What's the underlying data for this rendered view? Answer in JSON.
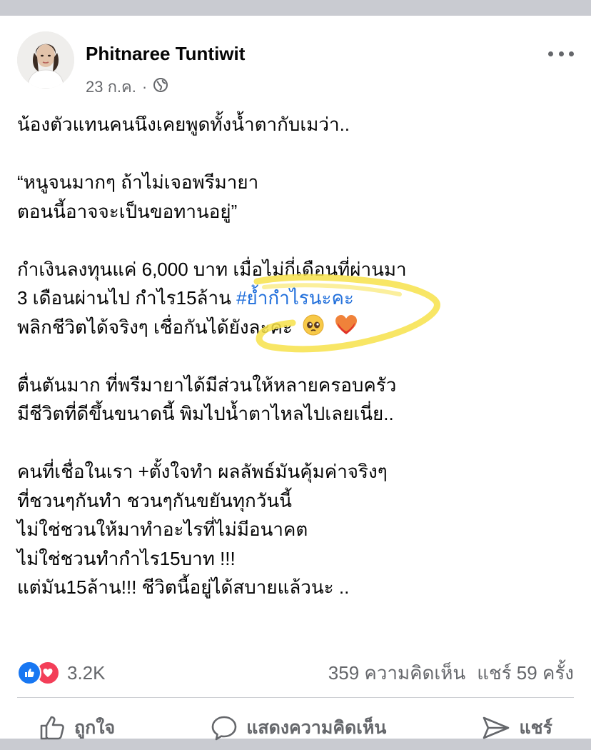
{
  "post": {
    "author": "Phitnaree Tuntiwit",
    "date": "23 ก.ค.",
    "separator": "·",
    "privacy_icon": "globe-icon"
  },
  "body": {
    "p1": "น้องตัวแทนคนนึงเคยพูดทั้งน้ำตากับเมว่า..",
    "p2_l1": "“หนูจนมากๆ ถ้าไม่เจอพรีมายา",
    "p2_l2": "ตอนนี้อาจจะเป็นขอทานอยู่”",
    "p3_l1": "กำเงินลงทุนแค่ 6,000 บาท เมื่อไม่กี่เดือนที่ผ่านมา",
    "p3_l2_text": "3 เดือนผ่านไป กำไร15ล้าน ",
    "p3_l2_hashtag": "#ย้ำกำไรนะคะ",
    "p3_l3": "พลิกชีวิตได้จริงๆ เชื่อกันได้ยังละคะ",
    "p4_l1": "ตื่นตันมาก ที่พรีมายาได้มีส่วนให้หลายครอบครัว",
    "p4_l2": "มีชีวิตที่ดีขึ้นขนาดนี้ พิมไปน้ำตาไหลไปเลยเนี่ย..",
    "p5_l1": "คนที่เชื่อในเรา +ตั้งใจทำ  ผลลัพธ์มันคุ้มค่าจริงๆ",
    "p5_l2": "ที่ชวนๆกันทำ ชวนๆกันขยันทุกวันนี้",
    "p5_l3": "ไม่ใช่ชวนให้มาทำอะไรที่ไม่มีอนาคต",
    "p5_l4": "ไม่ใช่ชวนทำกำไร15บาท !!!",
    "p5_l5": "แต่มัน15ล้าน!!! ชีวิตนี้อยู่ได้สบายแล้วนะ .."
  },
  "colors": {
    "hashtag": "#216fdb",
    "highlighter": "#f7e24a",
    "like": "#1877f2",
    "love": "#f33e58"
  },
  "stats": {
    "reactions": "3.2K",
    "comments": "359 ความคิดเห็น",
    "shares": "แชร์ 59 ครั้ง"
  },
  "actions": {
    "like": "ถูกใจ",
    "comment": "แสดงความคิดเห็น",
    "share": "แชร์"
  }
}
